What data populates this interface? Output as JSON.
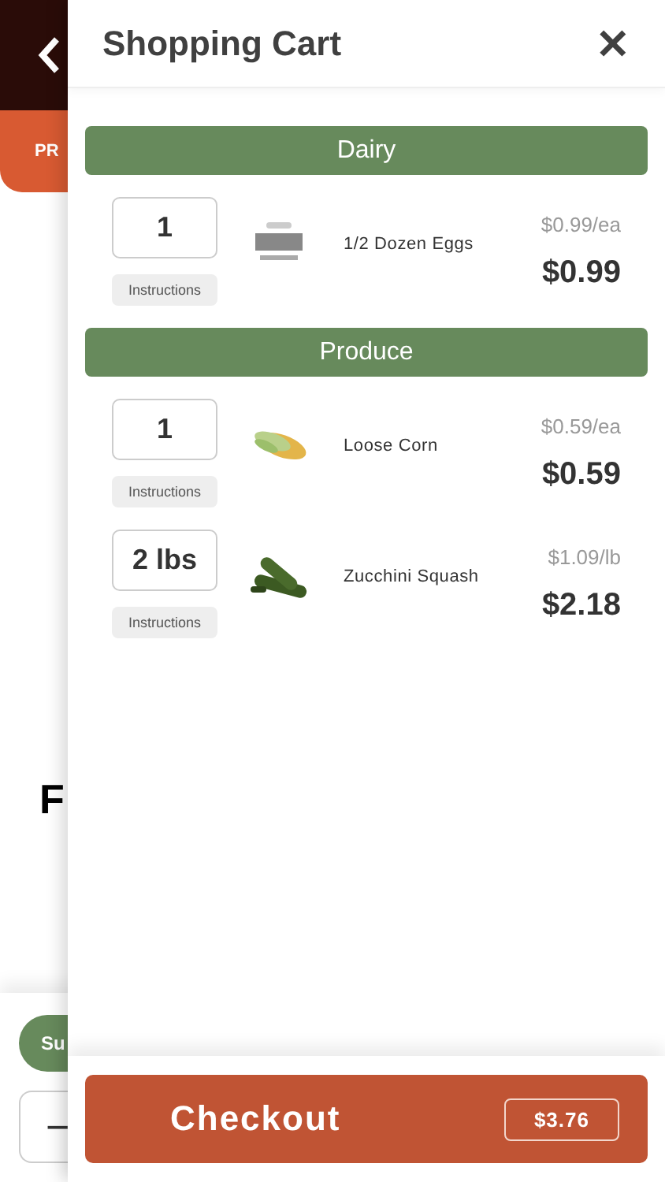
{
  "background_page": {
    "banner_label": "PR",
    "heading": "F",
    "pill": "Su",
    "stepper": "−"
  },
  "cart": {
    "title": "Shopping Cart",
    "close": "✕",
    "sections": [
      {
        "name": "Dairy",
        "items": [
          {
            "quantity": "1",
            "instructions": "Instructions",
            "name": "1/2 Dozen Eggs",
            "unit_price": "$0.99/ea",
            "total": "$0.99"
          }
        ]
      },
      {
        "name": "Produce",
        "items": [
          {
            "quantity": "1",
            "instructions": "Instructions",
            "name": "Loose Corn",
            "unit_price": "$0.59/ea",
            "total": "$0.59"
          },
          {
            "quantity": "2 lbs",
            "instructions": "Instructions",
            "name": "Zucchini Squash",
            "unit_price": "$1.09/lb",
            "total": "$2.18"
          }
        ]
      }
    ],
    "checkout": {
      "label": "Checkout",
      "total": "$3.76"
    }
  }
}
